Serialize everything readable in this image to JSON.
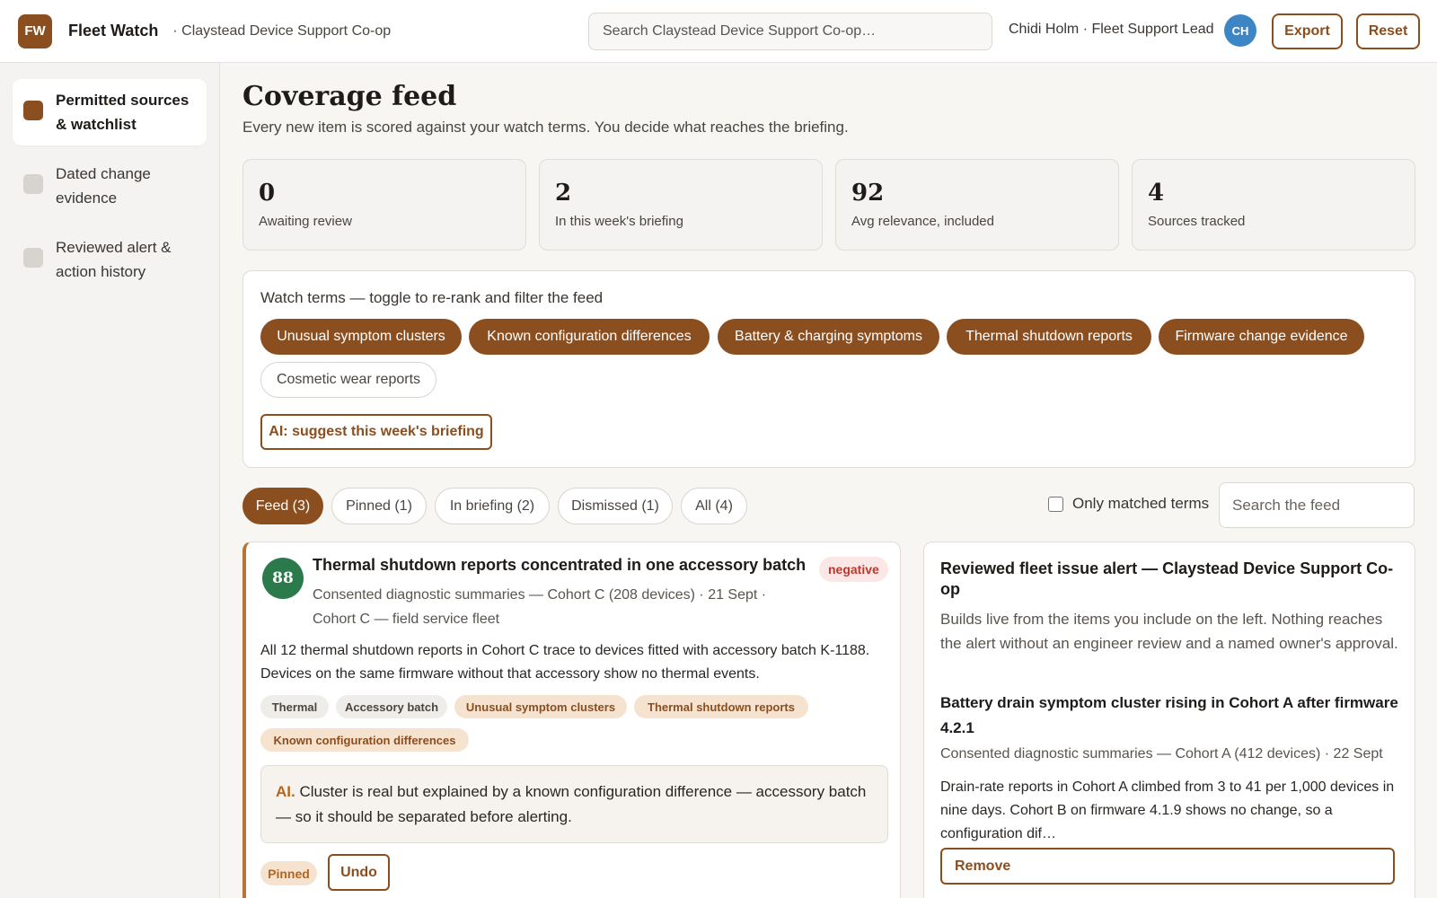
{
  "header": {
    "logo_text": "FW",
    "app_name": "Fleet Watch",
    "org_name": "· Claystead Device Support Co-op",
    "search_placeholder": "Search Claystead Device Support Co-op…",
    "user": "Chidi Holm · Fleet Support Lead",
    "avatar_initials": "CH",
    "export_label": "Export",
    "reset_label": "Reset"
  },
  "sidebar": {
    "items": [
      {
        "label": "Permitted sources & watchlist",
        "active": true
      },
      {
        "label": "Dated change evidence",
        "active": false
      },
      {
        "label": "Reviewed alert & action history",
        "active": false
      }
    ]
  },
  "page": {
    "title": "Coverage feed",
    "subtitle": "Every new item is scored against your watch terms. You decide what reaches the briefing."
  },
  "stats": [
    {
      "value": "0",
      "label": "Awaiting review"
    },
    {
      "value": "2",
      "label": "In this week's briefing"
    },
    {
      "value": "92",
      "label": "Avg relevance, included"
    },
    {
      "value": "4",
      "label": "Sources tracked"
    }
  ],
  "watch_terms": {
    "title": "Watch terms — toggle to re-rank and filter the feed",
    "terms": [
      {
        "label": "Unusual symptom clusters",
        "active": true
      },
      {
        "label": "Known configuration differences",
        "active": true
      },
      {
        "label": "Battery & charging symptoms",
        "active": true
      },
      {
        "label": "Thermal shutdown reports",
        "active": true
      },
      {
        "label": "Firmware change evidence",
        "active": true
      },
      {
        "label": "Cosmetic wear reports",
        "active": false
      }
    ],
    "ai_button": "AI: suggest this week's briefing"
  },
  "tabs": [
    {
      "label": "Feed (3)",
      "active": true
    },
    {
      "label": "Pinned (1)",
      "active": false
    },
    {
      "label": "In briefing (2)",
      "active": false
    },
    {
      "label": "Dismissed (1)",
      "active": false
    },
    {
      "label": "All (4)",
      "active": false
    }
  ],
  "filter": {
    "only_matched_label": "Only matched terms",
    "only_matched_checked": false,
    "search_placeholder": "Search the feed"
  },
  "feed_card": {
    "score": "88",
    "title": "Thermal shutdown reports concentrated in one accessory batch",
    "sentiment": "negative",
    "meta": "Consented diagnostic summaries — Cohort C (208 devices) · 21 Sept · Cohort C — field service fleet",
    "body": "All 12 thermal shutdown reports in Cohort C trace to devices fitted with accessory batch K-1188. Devices on the same firmware without that accessory show no thermal events.",
    "tags": [
      {
        "label": "Thermal",
        "kind": "neutral"
      },
      {
        "label": "Accessory batch",
        "kind": "neutral"
      },
      {
        "label": "Unusual symptom clusters",
        "kind": "match"
      },
      {
        "label": "Thermal shutdown reports",
        "kind": "match"
      },
      {
        "label": "Known configuration differences",
        "kind": "match"
      }
    ],
    "ai_label": "AI.",
    "ai_text": "Cluster is real but explained by a known configuration difference — accessory batch — so it should be separated before alerting.",
    "status": "Pinned",
    "undo_label": "Undo"
  },
  "alert_panel": {
    "title": "Reviewed fleet issue alert — Claystead Device Support Co-op",
    "description": "Builds live from the items you include on the left. Nothing reaches the alert without an engineer review and a named owner's approval.",
    "item_title": "Battery drain symptom cluster rising in Cohort A after firmware 4.2.1",
    "item_meta": "Consented diagnostic summaries — Cohort A (412 devices) · 22 Sept",
    "item_body": "Drain-rate reports in Cohort A climbed from 3 to 41 per 1,000 devices in nine days. Cohort B on firmware 4.1.9 shows no change, so a configuration dif…",
    "remove_label": "Remove"
  }
}
